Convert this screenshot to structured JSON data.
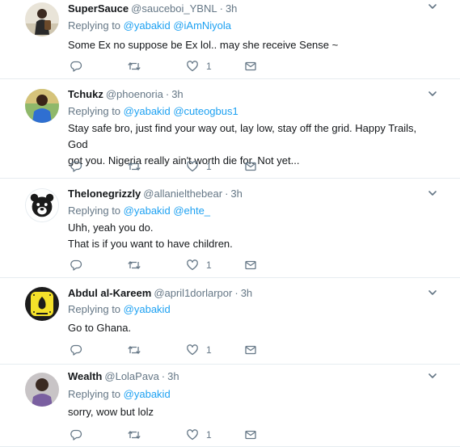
{
  "tweets": [
    {
      "name": "SuperSauce",
      "handle": "@sauceboi_YBNL",
      "time": "3h",
      "replying_prefix": "Replying to",
      "mentions": [
        "@yabakid",
        "@iAmNiyola"
      ],
      "lines": [
        "Some Ex no suppose be Ex lol.. may she receive  Sense  ~"
      ],
      "like_count": "1",
      "avatar": "person-with-backpack-avatar"
    },
    {
      "name": "Tchukz",
      "handle": "@phoenoria",
      "time": "3h",
      "replying_prefix": "Replying to",
      "mentions": [
        "@yabakid",
        "@cuteogbus1"
      ],
      "lines": [
        "Stay safe bro, just find your way out, lay low, stay off the grid. Happy Trails, God",
        "got you. Nigeria really ain't worth die for. Not yet..."
      ],
      "like_count": "1",
      "avatar": "person-blue-shirt-avatar"
    },
    {
      "name": "Thelonegrizzly",
      "handle": "@allanielthebear",
      "time": "3h",
      "replying_prefix": "Replying to",
      "mentions": [
        "@yabakid",
        "@ehte_"
      ],
      "lines": [
        "Uhh, yeah you do.",
        "That is if you want to have children."
      ],
      "like_count": "1",
      "avatar": "bear-illustration-avatar"
    },
    {
      "name": "Abdul al-Kareem",
      "handle": "@april1dorlarpor",
      "time": "3h",
      "replying_prefix": "Replying to",
      "mentions": [
        "@yabakid"
      ],
      "lines": [
        "Go to Ghana."
      ],
      "like_count": "1",
      "avatar": "snapcode-avatar"
    },
    {
      "name": "Wealth",
      "handle": "@LolaPava",
      "time": "3h",
      "replying_prefix": "Replying to",
      "mentions": [
        "@yabakid"
      ],
      "lines": [
        "sorry, wow but lolz"
      ],
      "like_count": "1",
      "avatar": "person-photo-avatar"
    }
  ],
  "colors": {
    "accent": "#1da1f2",
    "muted": "#657786",
    "text": "#14171a",
    "divider": "#e6ecf0"
  }
}
